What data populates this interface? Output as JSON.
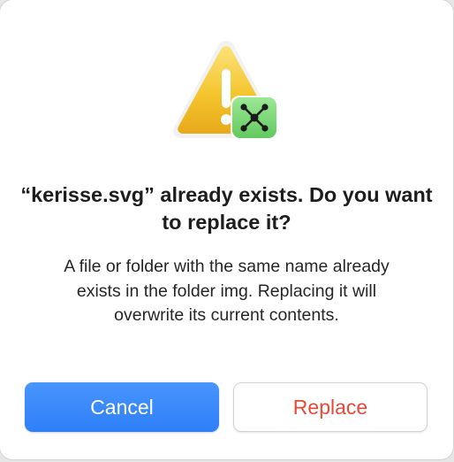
{
  "dialog": {
    "icon": "warning-triangle-icon",
    "badge_icon": "app-network-badge-icon",
    "title": "“kerisse.svg” already exists. Do you want to replace it?",
    "message": "A file or folder with the same name already exists in the folder img. Replacing it will overwrite its current contents.",
    "buttons": {
      "cancel_label": "Cancel",
      "replace_label": "Replace"
    },
    "colors": {
      "primary_button": "#2f7ff8",
      "destructive_text": "#e5493a",
      "warning_yellow": "#f7c935",
      "badge_green": "#7ed87a"
    }
  }
}
